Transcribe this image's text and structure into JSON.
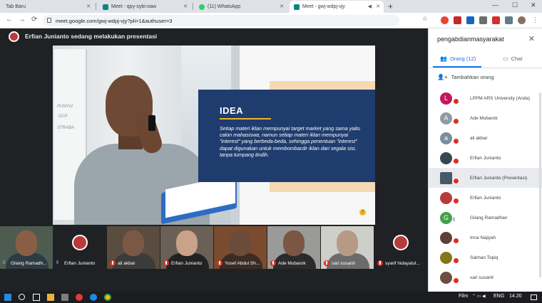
{
  "browser": {
    "tabs": [
      {
        "label": "Tab Baru",
        "favicon_color": "#4285f4"
      },
      {
        "label": "Meet - qpy-sybi-oaw",
        "favicon_color": "#00897b"
      },
      {
        "label": "(11) WhatsApp",
        "favicon_color": "#25d366"
      },
      {
        "label": "Meet - gwj-wdpj-vjy",
        "favicon_color": "#00897b"
      }
    ],
    "new_tab": "+",
    "url": "meet.google.com/gwj-wdpj-vjy?pli=1&authuser=3",
    "window_controls": {
      "minimize": "—",
      "maximize": "☐",
      "close": "✕"
    },
    "nav": {
      "back": "←",
      "forward": "→",
      "reload": "⟳"
    }
  },
  "meet": {
    "presenter_text": "Erfian Junianto sedang melakukan presentasi",
    "slide": {
      "wb_texts": [
        "PUNYAI",
        "DCP",
        "STRABA"
      ],
      "idea_title": "IDEA",
      "idea_body": "Setiap materi iklan mempunyai target market yang sama yaitu calon mahasiswa, namun setiap materi iklan mempunyai \"interest\" yang berbeda-beda, sehingga penentuan \"interest\" dapat digunakan untuk membombardir iklan dari segala sisi, tanpa tumpang tindih.",
      "page_number": "2"
    },
    "participants": [
      {
        "name": "Gilang Ramadh...",
        "face": "#8a5e45",
        "body": "#2e3b44",
        "bg": "#4d5c4f",
        "speaking": true
      },
      {
        "name": "Erfian Junianto",
        "face": "#b83b3b",
        "body": "#202124",
        "bg": "#202124",
        "speaking": true,
        "avatar": true
      },
      {
        "name": "ali akbar",
        "face": "#7b5844",
        "body": "#3b3b3b",
        "bg": "#5a4d3f",
        "speaking": false
      },
      {
        "name": "Erfian Junianto",
        "face": "#caa189",
        "body": "#222",
        "bg": "#6b6055",
        "speaking": false
      },
      {
        "name": "Yosef Abdul Sh...",
        "face": "#6b4b39",
        "body": "#3a2c25",
        "bg": "#7a4b2f",
        "speaking": false
      },
      {
        "name": "Ade Mubarok",
        "face": "#7a5643",
        "body": "#2b2b2b",
        "bg": "#9a9a98",
        "speaking": false
      },
      {
        "name": "sari susanti",
        "face": "#b79a86",
        "body": "#6b6b6b",
        "bg": "#cfcfca",
        "speaking": false
      },
      {
        "name": "syarif hidayatul...",
        "face": "#b83b3b",
        "body": "#202124",
        "bg": "#202124",
        "speaking": false,
        "avatar": true
      }
    ]
  },
  "panel": {
    "title": "pengabdianmasyarakat",
    "close": "✕",
    "tab_people": "Orang (12)",
    "tab_chat": "Chat",
    "add_person": "Tambahkan orang",
    "people": [
      {
        "initial": "L",
        "name": "LPPM ARS University (Anda)",
        "color": "#c2185b",
        "state": "muted"
      },
      {
        "initial": "A",
        "name": "Ade Mubarok",
        "color": "#8e9aa6",
        "state": "muted"
      },
      {
        "initial": "a",
        "name": "ali akbar",
        "color": "#78909c",
        "state": "muted"
      },
      {
        "initial": "",
        "name": "Erfian Junianto",
        "color": "#37474f",
        "state": "muted"
      },
      {
        "initial": "",
        "name": "Erfian Junianto (Presentasi)",
        "color": "#455a64",
        "state": "presenting"
      },
      {
        "initial": "",
        "name": "Erfian Junianto",
        "color": "#b83b3b",
        "state": "muted"
      },
      {
        "initial": "G",
        "name": "Gilang Ramadhan",
        "color": "#43a047",
        "state": "speaking"
      },
      {
        "initial": "",
        "name": "Inna Najiyah",
        "color": "#5d4037",
        "state": "muted"
      },
      {
        "initial": "",
        "name": "Salman Topiq",
        "color": "#827717",
        "state": "muted"
      },
      {
        "initial": "",
        "name": "sari susanti",
        "color": "#6d4c41",
        "state": "muted"
      }
    ]
  },
  "taskbar": {
    "film_label": "Film",
    "lang": "ENG",
    "time": "14.20"
  }
}
